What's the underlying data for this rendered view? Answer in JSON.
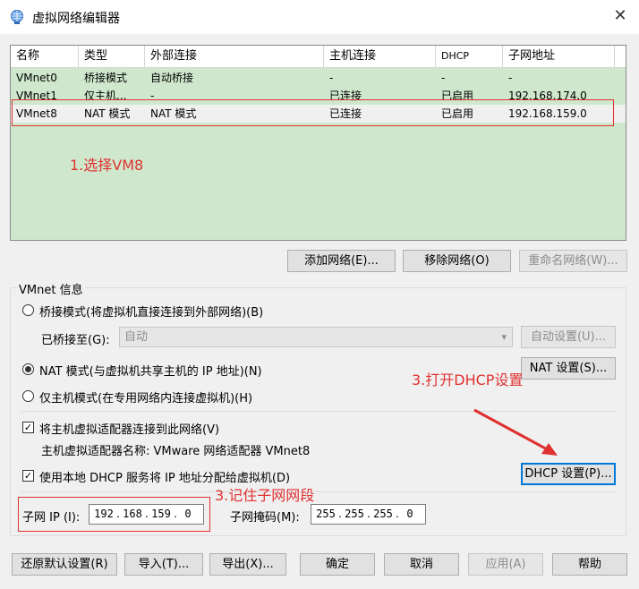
{
  "window": {
    "title": "虚拟网络编辑器",
    "close_glyph": "✕"
  },
  "table": {
    "headers": [
      "名称",
      "类型",
      "外部连接",
      "主机连接",
      "DHCP",
      "子网地址"
    ],
    "rows": [
      {
        "name": "VMnet0",
        "type": "桥接模式",
        "external": "自动桥接",
        "host": "-",
        "dhcp": "-",
        "subnet": "-"
      },
      {
        "name": "VMnet1",
        "type": "仅主机...",
        "external": "-",
        "host": "已连接",
        "dhcp": "已启用",
        "subnet": "192.168.174.0"
      },
      {
        "name": "VMnet8",
        "type": "NAT 模式",
        "external": "NAT 模式",
        "host": "已连接",
        "dhcp": "已启用",
        "subnet": "192.168.159.0"
      }
    ],
    "selected_row": "VMnet8"
  },
  "annotations": {
    "step1": "1.选择VM8",
    "step3a": "3.打开DHCP设置",
    "step3b": "3.记住子网网段"
  },
  "network_buttons": {
    "add": "添加网络(E)...",
    "remove": "移除网络(O)",
    "rename": "重命名网络(W)..."
  },
  "vmnet_info": {
    "group_label": "VMnet 信息",
    "bridge_radio": "桥接模式(将虚拟机直接连接到外部网络)(B)",
    "bridged_to_label": "已桥接至(G):",
    "bridged_to_value": "自动",
    "auto_settings": "自动设置(U)...",
    "nat_radio": "NAT 模式(与虚拟机共享主机的 IP 地址)(N)",
    "nat_settings": "NAT 设置(S)...",
    "host_only_radio": "仅主机模式(在专用网络内连接虚拟机)(H)",
    "selected_mode": "NAT",
    "connect_adapter_check": "将主机虚拟适配器连接到此网络(V)",
    "connect_adapter_checked": true,
    "adapter_name": "主机虚拟适配器名称: VMware 网络适配器 VMnet8",
    "dhcp_check": "使用本地 DHCP 服务将 IP 地址分配给虚拟机(D)",
    "dhcp_checked": true,
    "dhcp_settings": "DHCP 设置(P)...",
    "subnet_ip_label": "子网 IP (I):",
    "subnet_ip": [
      "192",
      "168",
      "159",
      "0"
    ],
    "subnet_mask_label": "子网掩码(M):",
    "subnet_mask": [
      "255",
      "255",
      "255",
      "0"
    ]
  },
  "footer": {
    "restore": "还原默认设置(R)",
    "import": "导入(T)...",
    "export": "导出(X)...",
    "ok": "确定",
    "cancel": "取消",
    "apply": "应用(A)",
    "help": "帮助"
  },
  "colors": {
    "table_bg": "#cfe8cd",
    "annotation_red": "#e03131",
    "default_button_border": "#0078d7"
  }
}
